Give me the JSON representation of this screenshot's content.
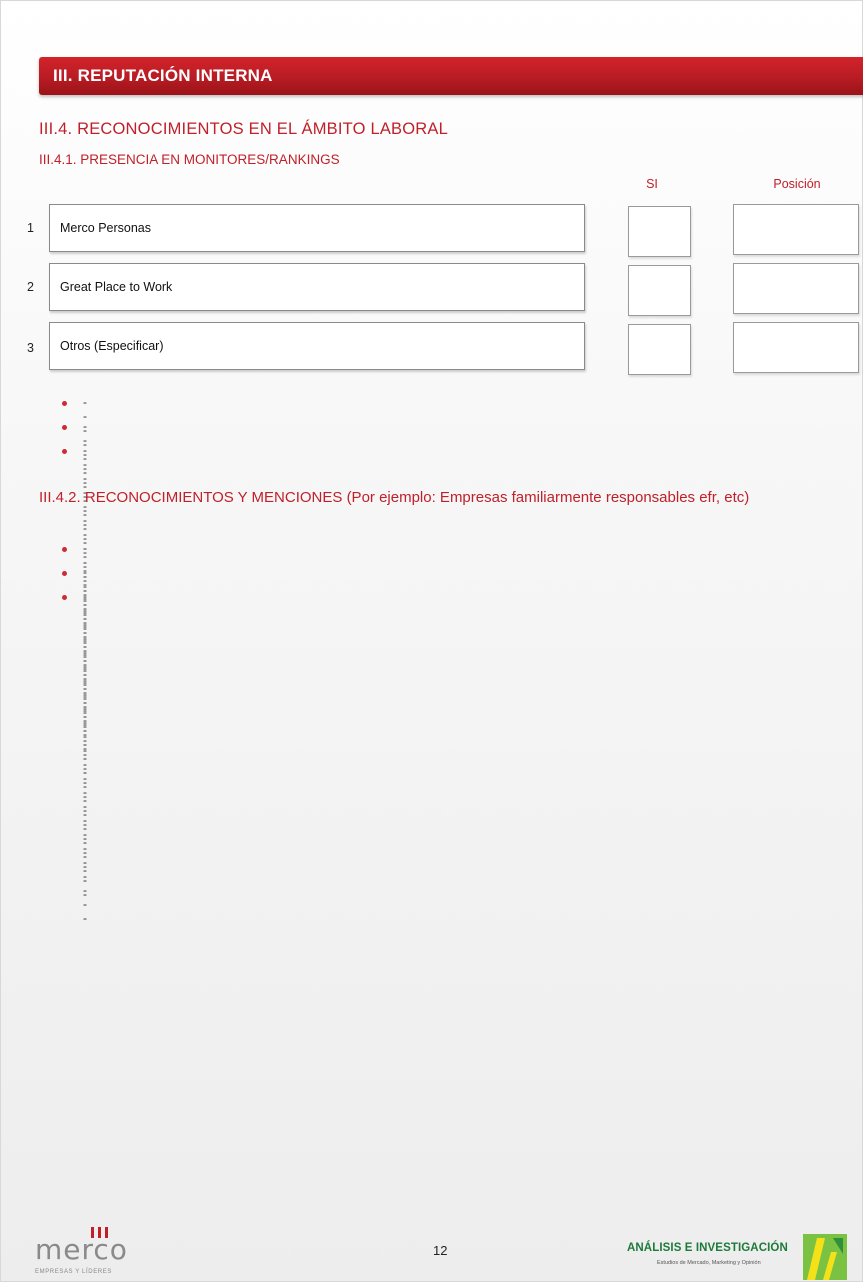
{
  "section": {
    "title": "III. REPUTACIÓN INTERNA"
  },
  "subsection": {
    "title": "III.4. RECONOCIMIENTOS EN EL ÁMBITO LABORAL",
    "sub_title": "III.4.1. PRESENCIA EN MONITORES/RANKINGS"
  },
  "columns": {
    "si": "SI",
    "posicion": "Posición"
  },
  "rows": [
    {
      "num": "1",
      "label": "Merco Personas"
    },
    {
      "num": "2",
      "label": "Great Place to Work"
    },
    {
      "num": "3",
      "label": "Otros (Especificar)"
    }
  ],
  "list_a": [
    "------------------------",
    "------------------------",
    "------------------------"
  ],
  "paragraph": "III.4.2. RECONOCIMIENTOS Y MENCIONES (Por ejemplo: Empresas familiarmente responsables efr, etc)",
  "list_b": [
    "------------------------",
    "------------------------",
    "------------------------"
  ],
  "footer": {
    "page_number": "12",
    "left_logo_word": "merco",
    "left_logo_tagline": "EMPRESAS Y LÍDERES",
    "right_logo_title": "ANÁLISIS E INVESTIGACIÓN",
    "right_logo_subtitle": "Estudios de Mercado, Marketing y Opinión"
  },
  "colors": {
    "accent": "#c0202a",
    "bar": "#b81c24",
    "logo_green": "#1d7a3a"
  }
}
